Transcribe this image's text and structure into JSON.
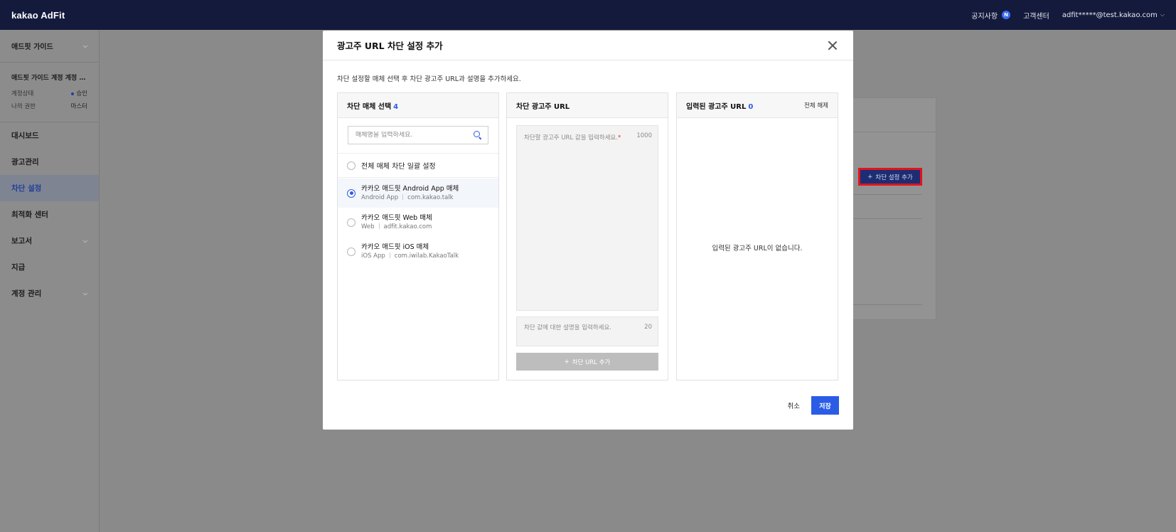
{
  "header": {
    "logo": "kakao AdFit",
    "notice_label": "공지사항",
    "notice_badge": "N",
    "support_label": "고객센터",
    "account_email": "adfit*****@test.kakao.com"
  },
  "sidebar": {
    "guide_label": "애드핏 가이드",
    "account_name": "애드핏 가이드 계정 계정 설...",
    "status_key": "계정상태",
    "status_value": "승인",
    "role_key": "나의 권한",
    "role_value": "마스터",
    "items": [
      {
        "label": "대시보드"
      },
      {
        "label": "광고관리"
      },
      {
        "label": "차단 설정"
      },
      {
        "label": "최적화 센터"
      },
      {
        "label": "보고서"
      },
      {
        "label": "지급"
      },
      {
        "label": "계정 관리"
      }
    ]
  },
  "background": {
    "add_block_setting": "차단 설정 추가"
  },
  "modal": {
    "title": "광고주 URL 차단 설정 추가",
    "description": "차단 설정할 매체 선택 후 차단 광고주 URL과 설명을 추가하세요.",
    "media_col": {
      "title": "차단 매체 선택",
      "count": "4",
      "search_placeholder": "매체명을 입력하세요.",
      "all_label": "전체 매체 차단 일괄 설정",
      "items": [
        {
          "name": "카카오 애드핏 Android App 매체",
          "type": "Android App",
          "id": "com.kakao.talk"
        },
        {
          "name": "카카오 애드핏 Web 매체",
          "type": "Web",
          "id": "adfit.kakao.com"
        },
        {
          "name": "카카오 애드핏 iOS 매체",
          "type": "iOS App",
          "id": "com.iwilab.KakaoTalk"
        }
      ]
    },
    "url_col": {
      "title": "차단 광고주 URL",
      "url_placeholder": "차단할 광고주 URL 값을 입력하세요.",
      "url_required": "*",
      "url_max": "1000",
      "desc_placeholder": "차단 값에 대한 설명을 입력하세요.",
      "desc_max": "20",
      "add_button": "차단 URL 추가"
    },
    "entered_col": {
      "title": "입력된 광고주 URL",
      "count": "0",
      "release_all": "전체 해제",
      "empty_message": "입력된 광고주 URL이 없습니다."
    },
    "footer": {
      "cancel": "취소",
      "save": "저장"
    }
  }
}
